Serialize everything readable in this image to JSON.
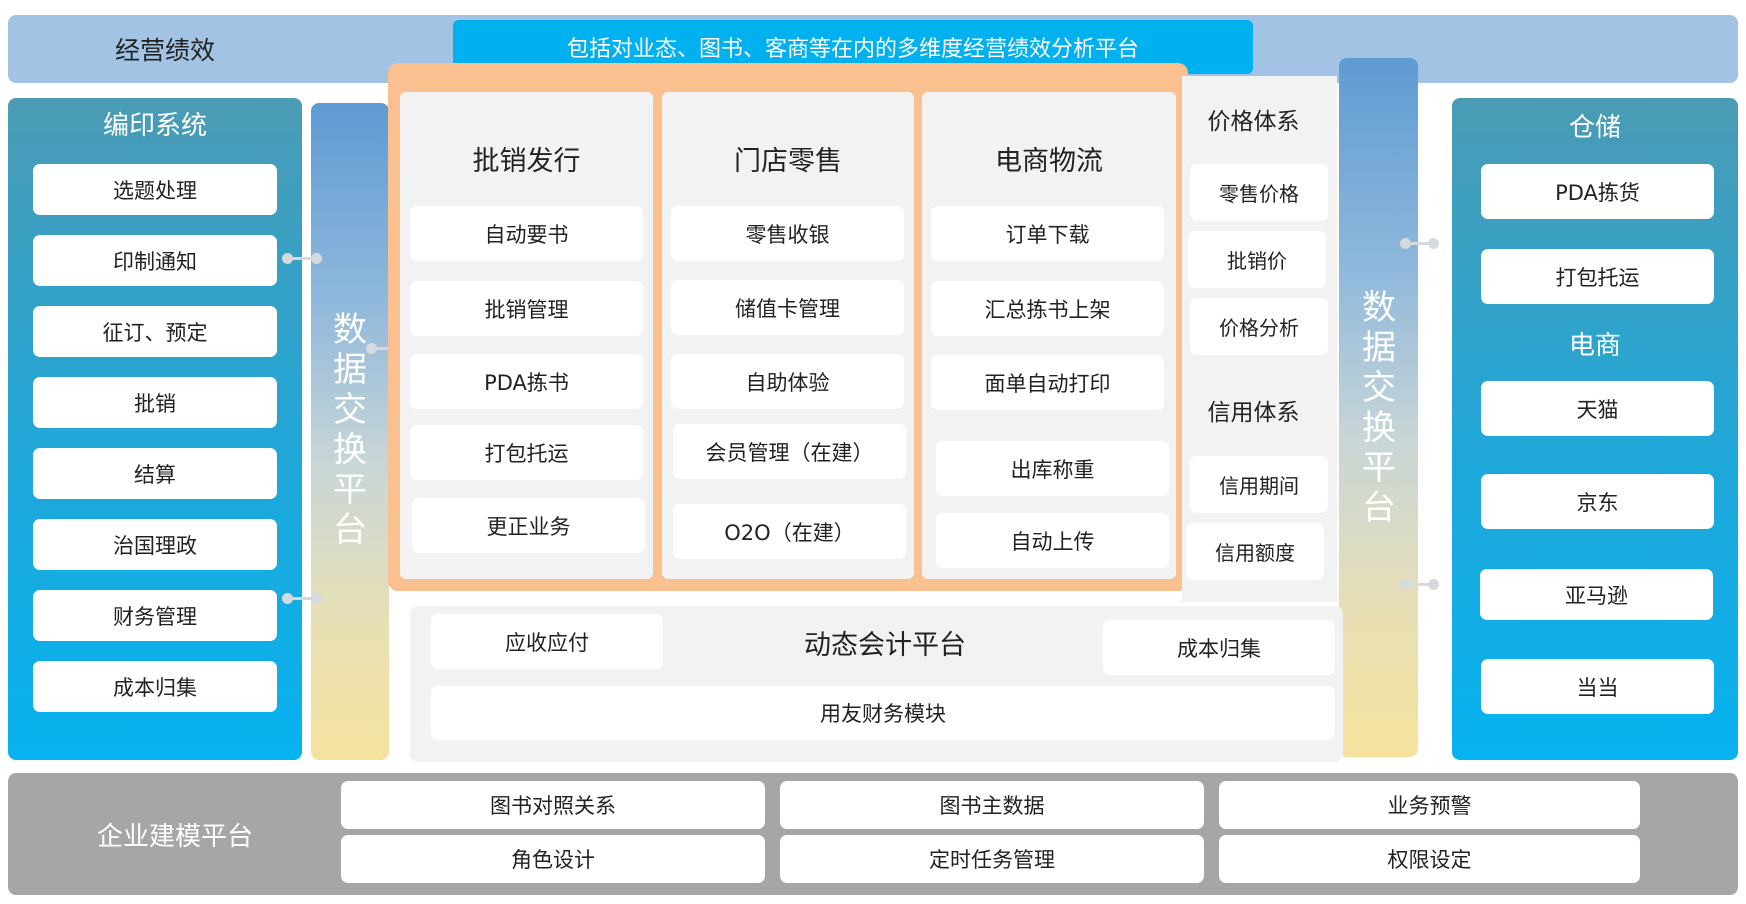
{
  "top": {
    "title": "经营绩效",
    "banner": "包括对业态、图书、客商等在内的多维度经营绩效分析平台"
  },
  "left_panel": {
    "title": "编印系统",
    "items": [
      "选题处理",
      "印制通知",
      "征订、预定",
      "批销",
      "结算",
      "治国理政",
      "财务管理",
      "成本归集"
    ]
  },
  "exchange_left": "数据交换平台",
  "exchange_right": "数据交换平台",
  "columns": [
    {
      "title": "批销发行",
      "items": [
        "自动要书",
        "批销管理",
        "PDA拣书",
        "打包托运",
        "更正业务"
      ]
    },
    {
      "title": "门店零售",
      "items": [
        "零售收银",
        "储值卡管理",
        "自助体验",
        "会员管理（在建）",
        "O2O（在建）"
      ]
    },
    {
      "title": "电商物流",
      "items": [
        "订单下载",
        "汇总拣书上架",
        "面单自动打印",
        "出库称重",
        "自动上传"
      ]
    }
  ],
  "price": {
    "title": "价格体系",
    "items": [
      "零售价格",
      "批销价",
      "价格分析"
    ]
  },
  "credit": {
    "title": "信用体系",
    "items": [
      "信用期间",
      "信用额度"
    ]
  },
  "accounting": {
    "title": "动态会计平台",
    "left_item": "应收应付",
    "right_item": "成本归集",
    "wide_item": "用友财务模块"
  },
  "right_panel": {
    "storage_title": "仓储",
    "storage_items": [
      "PDA拣货",
      "打包托运"
    ],
    "ecom_title": "电商",
    "ecom_items": [
      "天猫",
      "京东",
      "亚马逊",
      "当当"
    ]
  },
  "bottom": {
    "title": "企业建模平台",
    "items": [
      "图书对照关系",
      "图书主数据",
      "业务预警",
      "角色设计",
      "定时任务管理",
      "权限设定"
    ]
  },
  "colors": {
    "top_band": "#a2c3e4",
    "banner": "#00b0ef",
    "side_panel": "#1fa7d9",
    "orange_frame": "#fbc08f",
    "bottom_band": "#a6a6a6"
  }
}
